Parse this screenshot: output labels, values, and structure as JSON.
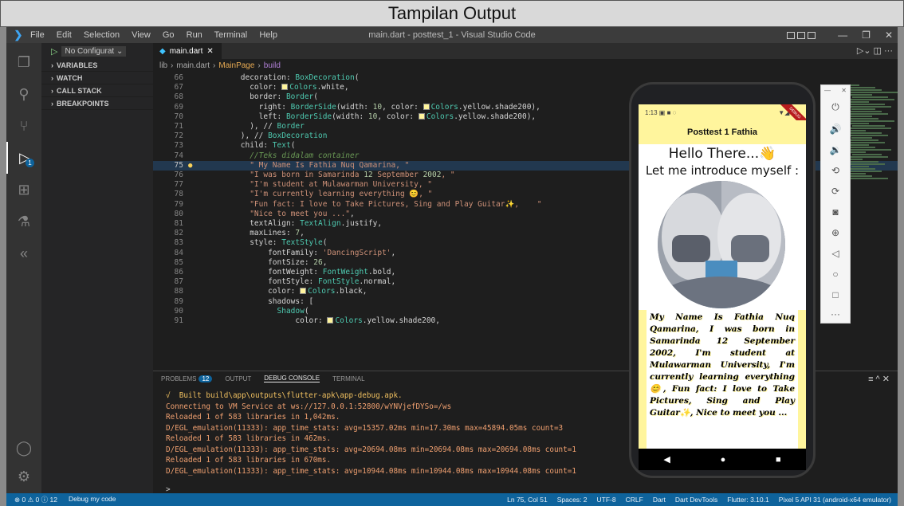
{
  "banner": "Tampilan Output",
  "titlebar": {
    "menu": [
      "File",
      "Edit",
      "Selection",
      "View",
      "Go",
      "Run",
      "Terminal",
      "Help"
    ],
    "window_title": "main.dart - posttest_1 - Visual Studio Code"
  },
  "sidebar": {
    "config": "No Configurat",
    "sections": [
      "VARIABLES",
      "WATCH",
      "CALL STACK",
      "BREAKPOINTS"
    ]
  },
  "activity_badge": "1",
  "tab": {
    "label": "main.dart"
  },
  "breadcrumb": {
    "lib": "lib",
    "file": "main.dart",
    "class": "MainPage",
    "method": "build"
  },
  "code_lines": [
    {
      "n": "66",
      "t": "        decoration: BoxDecoration("
    },
    {
      "n": "67",
      "t": "          color: Colors.white,"
    },
    {
      "n": "68",
      "t": "          border: Border("
    },
    {
      "n": "69",
      "t": "            right: BorderSide(width: 10, color: Colors.yellow.shade200),"
    },
    {
      "n": "70",
      "t": "            left: BorderSide(width: 10, color: Colors.yellow.shade200),"
    },
    {
      "n": "71",
      "t": "          ), // Border"
    },
    {
      "n": "72",
      "t": "        ), // BoxDecoration"
    },
    {
      "n": "73",
      "t": "        child: Text("
    },
    {
      "n": "74",
      "t": "          //Teks didalam container"
    },
    {
      "n": "75",
      "t": "          \" My Name Is Fathia Nuq Qamarina, \""
    },
    {
      "n": "76",
      "t": "          \"I was born in Samarinda 12 September 2002, \""
    },
    {
      "n": "77",
      "t": "          \"I'm student at Mulawarman University, \""
    },
    {
      "n": "78",
      "t": "          \"I'm currently learning everything 😊, \""
    },
    {
      "n": "79",
      "t": "          \"Fun fact: I love to Take Pictures, Sing and Play Guitar✨,    \""
    },
    {
      "n": "80",
      "t": "          \"Nice to meet you ...\","
    },
    {
      "n": "81",
      "t": "          textAlign: TextAlign.justify,"
    },
    {
      "n": "82",
      "t": "          maxLines: 7,"
    },
    {
      "n": "83",
      "t": "          style: TextStyle("
    },
    {
      "n": "84",
      "t": "              fontFamily: 'DancingScript',"
    },
    {
      "n": "85",
      "t": "              fontSize: 26,"
    },
    {
      "n": "86",
      "t": "              fontWeight: FontWeight.bold,"
    },
    {
      "n": "87",
      "t": "              fontStyle: FontStyle.normal,"
    },
    {
      "n": "88",
      "t": "              color: Colors.black,"
    },
    {
      "n": "89",
      "t": "              shadows: ["
    },
    {
      "n": "90",
      "t": "                Shadow("
    },
    {
      "n": "91",
      "t": "                    color: Colors.yellow.shade200,"
    }
  ],
  "panel": {
    "tabs": [
      "PROBLEMS",
      "OUTPUT",
      "DEBUG CONSOLE",
      "TERMINAL"
    ],
    "problems_count": "12",
    "lines": [
      "√  Built build\\app\\outputs\\flutter-apk\\app-debug.apk.",
      "Connecting to VM Service at ws://127.0.0.1:52800/wYNVjefDYSo=/ws",
      "Reloaded 1 of 583 libraries in 1,042ms.",
      "D/EGL_emulation(11333): app_time_stats: avg=15357.02ms min=17.30ms max=45894.05ms count=3",
      "Reloaded 1 of 583 libraries in 462ms.",
      "D/EGL_emulation(11333): app_time_stats: avg=20694.08ms min=20694.08ms max=20694.08ms count=1",
      "Reloaded 1 of 583 libraries in 670ms.",
      "D/EGL_emulation(11333): app_time_stats: avg=10944.08ms min=10944.08ms max=10944.08ms count=1"
    ],
    "prompt": ">"
  },
  "status": {
    "left": [
      "⊗ 0 ⚠ 0 ⓘ 12",
      "Debug my code"
    ],
    "right": [
      "Ln 75, Col 51",
      "Spaces: 2",
      "UTF-8",
      "CRLF",
      "Dart",
      "Dart DevTools",
      "Flutter: 3.10.1",
      "Pixel 5 API 31 (android-x64 emulator)"
    ]
  },
  "phone": {
    "time": "1:13",
    "debug_flag": "DEBUG",
    "app_title": "Posttest 1 Fathia",
    "hello": "Hello There...👋",
    "intro": "Let me introduce myself :",
    "bio": "My Name Is Fathia Nuq Qamarina, I was born in Samarinda 12 September 2002, I'm student at Mulawarman University, I'm currently learning everything 😊, Fun fact: I love to Take Pictures, Sing and Play Guitar✨, Nice to meet you ..."
  },
  "colors": {
    "accent": "#0e639c",
    "appbar": "#fff59d",
    "editor_bg": "#1e1e1e"
  },
  "icons": [
    "vscode-logo-icon",
    "explorer-icon",
    "search-icon",
    "source-control-icon",
    "run-debug-icon",
    "extensions-icon",
    "testing-icon",
    "flutter-icon",
    "account-icon",
    "settings-gear-icon",
    "power-icon",
    "volume-up-icon",
    "volume-down-icon",
    "rotate-left-icon",
    "rotate-right-icon",
    "camera-icon",
    "zoom-icon",
    "back-icon",
    "home-icon",
    "overview-icon",
    "more-icon"
  ]
}
